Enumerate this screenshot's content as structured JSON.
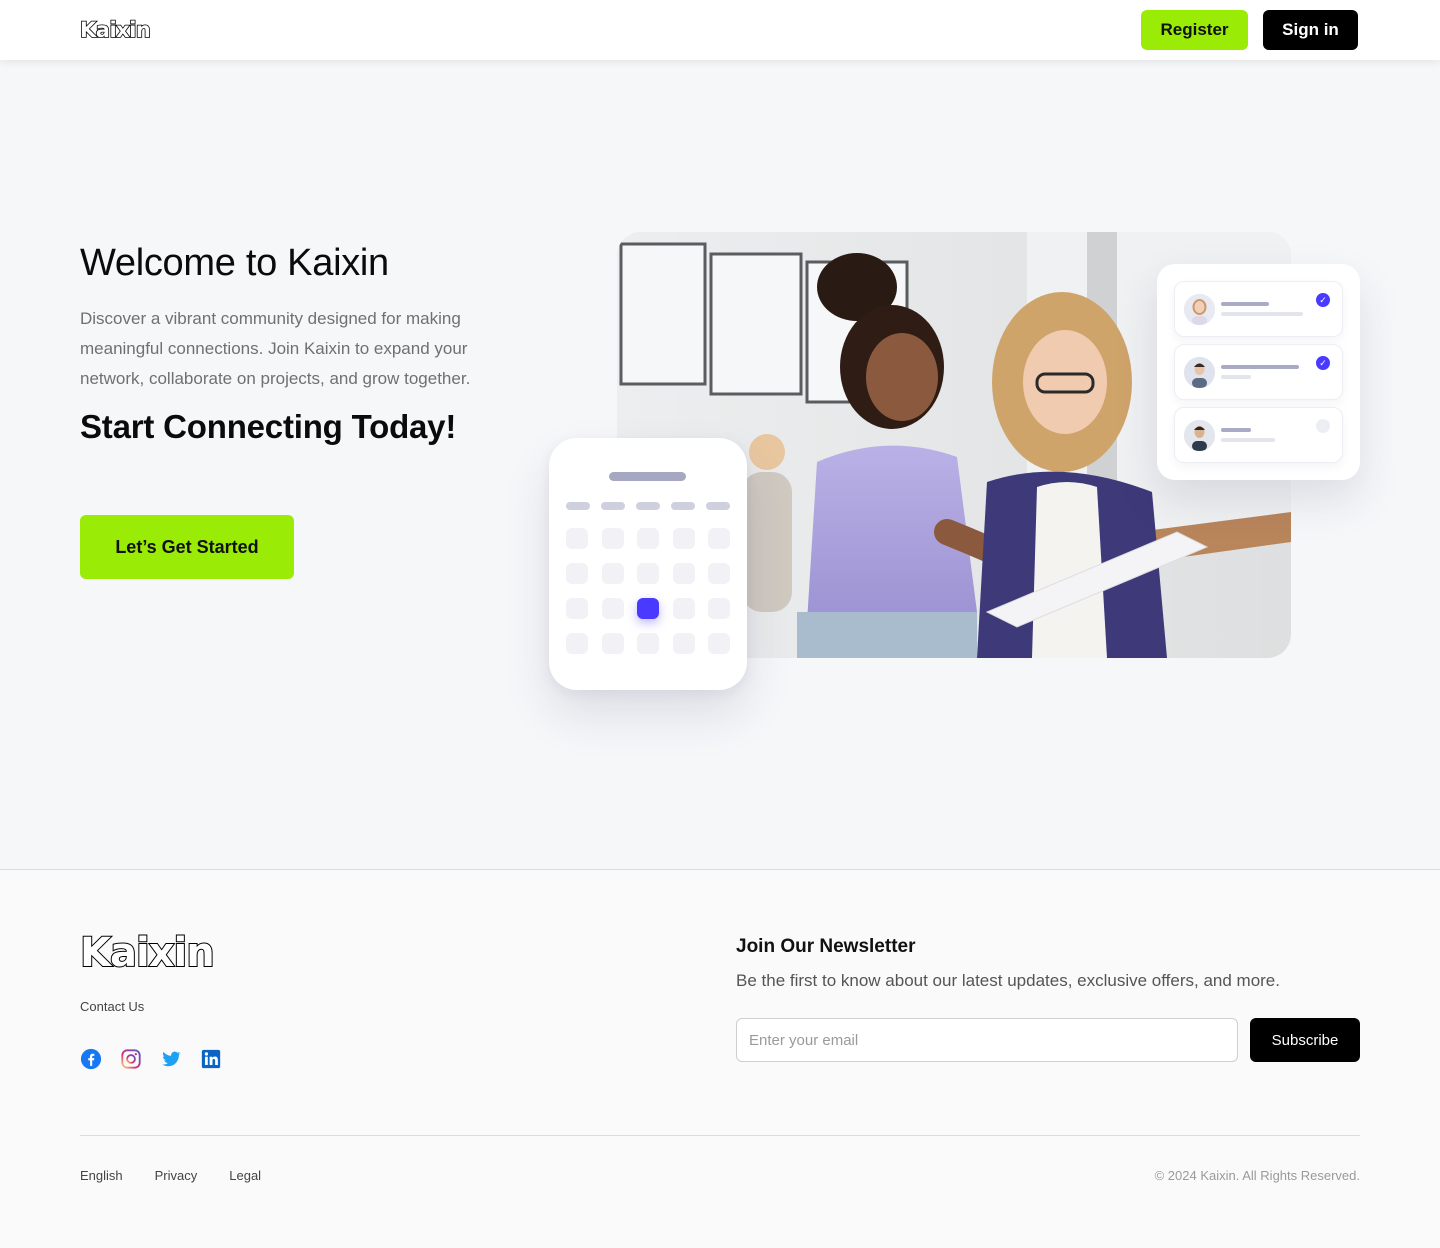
{
  "header": {
    "logo": "Kaixin",
    "register_label": "Register",
    "signin_label": "Sign in"
  },
  "hero": {
    "title": "Welcome to Kaixin",
    "description": "Discover a vibrant community designed for making meaningful connections. Join Kaixin to expand your network, collaborate on projects, and grow together.",
    "subtitle": "Start Connecting Today!",
    "cta_label": "Let’s Get Started"
  },
  "illustration": {
    "calendar": {
      "selected_week": 3,
      "selected_day": 3
    },
    "members": [
      {
        "avatar": "woman-avatar",
        "checked": true
      },
      {
        "avatar": "man-avatar",
        "checked": true
      },
      {
        "avatar": "man-avatar",
        "checked": false
      }
    ],
    "accent_color": "#4a3aff"
  },
  "footer": {
    "logo": "Kaixin",
    "contact_label": "Contact Us",
    "socials": [
      "facebook-icon",
      "instagram-icon",
      "twitter-icon",
      "linkedin-icon"
    ],
    "newsletter": {
      "title": "Join Our Newsletter",
      "description": "Be the first to know about our latest updates, exclusive offers, and more.",
      "email_placeholder": "Enter your email",
      "subscribe_label": "Subscribe"
    },
    "links": [
      "English",
      "Privacy",
      "Legal"
    ],
    "copyright": "© 2024 Kaixin. All Rights Reserved."
  },
  "colors": {
    "brand_green": "#9aeb05",
    "black": "#000000",
    "background": "#f6f7f9"
  }
}
